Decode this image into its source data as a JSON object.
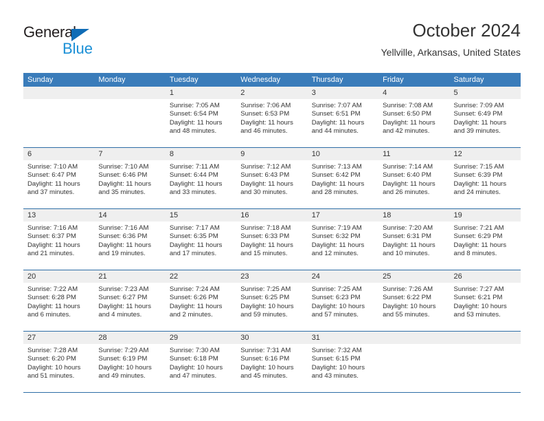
{
  "logo": {
    "word_top": "General",
    "word_bottom": "Blue",
    "triangle_color": "#0f6cb6",
    "blue_color": "#1a8fd6"
  },
  "header": {
    "title": "October 2024",
    "subtitle": "Yellville, Arkansas, United States"
  },
  "theme": {
    "header_blue": "#3a7cba",
    "rule_blue": "#2e6da6",
    "numbers_band": "#efefef",
    "text": "#333333"
  },
  "weekdays": [
    "Sunday",
    "Monday",
    "Tuesday",
    "Wednesday",
    "Thursday",
    "Friday",
    "Saturday"
  ],
  "weeks": [
    {
      "numbers": [
        "",
        "",
        "1",
        "2",
        "3",
        "4",
        "5"
      ],
      "days": [
        {
          "empty": true
        },
        {
          "empty": true
        },
        {
          "sunrise": "Sunrise: 7:05 AM",
          "sunset": "Sunset: 6:54 PM",
          "daylight1": "Daylight: 11 hours",
          "daylight2": "and 48 minutes."
        },
        {
          "sunrise": "Sunrise: 7:06 AM",
          "sunset": "Sunset: 6:53 PM",
          "daylight1": "Daylight: 11 hours",
          "daylight2": "and 46 minutes."
        },
        {
          "sunrise": "Sunrise: 7:07 AM",
          "sunset": "Sunset: 6:51 PM",
          "daylight1": "Daylight: 11 hours",
          "daylight2": "and 44 minutes."
        },
        {
          "sunrise": "Sunrise: 7:08 AM",
          "sunset": "Sunset: 6:50 PM",
          "daylight1": "Daylight: 11 hours",
          "daylight2": "and 42 minutes."
        },
        {
          "sunrise": "Sunrise: 7:09 AM",
          "sunset": "Sunset: 6:49 PM",
          "daylight1": "Daylight: 11 hours",
          "daylight2": "and 39 minutes."
        }
      ]
    },
    {
      "numbers": [
        "6",
        "7",
        "8",
        "9",
        "10",
        "11",
        "12"
      ],
      "days": [
        {
          "sunrise": "Sunrise: 7:10 AM",
          "sunset": "Sunset: 6:47 PM",
          "daylight1": "Daylight: 11 hours",
          "daylight2": "and 37 minutes."
        },
        {
          "sunrise": "Sunrise: 7:10 AM",
          "sunset": "Sunset: 6:46 PM",
          "daylight1": "Daylight: 11 hours",
          "daylight2": "and 35 minutes."
        },
        {
          "sunrise": "Sunrise: 7:11 AM",
          "sunset": "Sunset: 6:44 PM",
          "daylight1": "Daylight: 11 hours",
          "daylight2": "and 33 minutes."
        },
        {
          "sunrise": "Sunrise: 7:12 AM",
          "sunset": "Sunset: 6:43 PM",
          "daylight1": "Daylight: 11 hours",
          "daylight2": "and 30 minutes."
        },
        {
          "sunrise": "Sunrise: 7:13 AM",
          "sunset": "Sunset: 6:42 PM",
          "daylight1": "Daylight: 11 hours",
          "daylight2": "and 28 minutes."
        },
        {
          "sunrise": "Sunrise: 7:14 AM",
          "sunset": "Sunset: 6:40 PM",
          "daylight1": "Daylight: 11 hours",
          "daylight2": "and 26 minutes."
        },
        {
          "sunrise": "Sunrise: 7:15 AM",
          "sunset": "Sunset: 6:39 PM",
          "daylight1": "Daylight: 11 hours",
          "daylight2": "and 24 minutes."
        }
      ]
    },
    {
      "numbers": [
        "13",
        "14",
        "15",
        "16",
        "17",
        "18",
        "19"
      ],
      "days": [
        {
          "sunrise": "Sunrise: 7:16 AM",
          "sunset": "Sunset: 6:37 PM",
          "daylight1": "Daylight: 11 hours",
          "daylight2": "and 21 minutes."
        },
        {
          "sunrise": "Sunrise: 7:16 AM",
          "sunset": "Sunset: 6:36 PM",
          "daylight1": "Daylight: 11 hours",
          "daylight2": "and 19 minutes."
        },
        {
          "sunrise": "Sunrise: 7:17 AM",
          "sunset": "Sunset: 6:35 PM",
          "daylight1": "Daylight: 11 hours",
          "daylight2": "and 17 minutes."
        },
        {
          "sunrise": "Sunrise: 7:18 AM",
          "sunset": "Sunset: 6:33 PM",
          "daylight1": "Daylight: 11 hours",
          "daylight2": "and 15 minutes."
        },
        {
          "sunrise": "Sunrise: 7:19 AM",
          "sunset": "Sunset: 6:32 PM",
          "daylight1": "Daylight: 11 hours",
          "daylight2": "and 12 minutes."
        },
        {
          "sunrise": "Sunrise: 7:20 AM",
          "sunset": "Sunset: 6:31 PM",
          "daylight1": "Daylight: 11 hours",
          "daylight2": "and 10 minutes."
        },
        {
          "sunrise": "Sunrise: 7:21 AM",
          "sunset": "Sunset: 6:29 PM",
          "daylight1": "Daylight: 11 hours",
          "daylight2": "and 8 minutes."
        }
      ]
    },
    {
      "numbers": [
        "20",
        "21",
        "22",
        "23",
        "24",
        "25",
        "26"
      ],
      "days": [
        {
          "sunrise": "Sunrise: 7:22 AM",
          "sunset": "Sunset: 6:28 PM",
          "daylight1": "Daylight: 11 hours",
          "daylight2": "and 6 minutes."
        },
        {
          "sunrise": "Sunrise: 7:23 AM",
          "sunset": "Sunset: 6:27 PM",
          "daylight1": "Daylight: 11 hours",
          "daylight2": "and 4 minutes."
        },
        {
          "sunrise": "Sunrise: 7:24 AM",
          "sunset": "Sunset: 6:26 PM",
          "daylight1": "Daylight: 11 hours",
          "daylight2": "and 2 minutes."
        },
        {
          "sunrise": "Sunrise: 7:25 AM",
          "sunset": "Sunset: 6:25 PM",
          "daylight1": "Daylight: 10 hours",
          "daylight2": "and 59 minutes."
        },
        {
          "sunrise": "Sunrise: 7:25 AM",
          "sunset": "Sunset: 6:23 PM",
          "daylight1": "Daylight: 10 hours",
          "daylight2": "and 57 minutes."
        },
        {
          "sunrise": "Sunrise: 7:26 AM",
          "sunset": "Sunset: 6:22 PM",
          "daylight1": "Daylight: 10 hours",
          "daylight2": "and 55 minutes."
        },
        {
          "sunrise": "Sunrise: 7:27 AM",
          "sunset": "Sunset: 6:21 PM",
          "daylight1": "Daylight: 10 hours",
          "daylight2": "and 53 minutes."
        }
      ]
    },
    {
      "numbers": [
        "27",
        "28",
        "29",
        "30",
        "31",
        "",
        ""
      ],
      "days": [
        {
          "sunrise": "Sunrise: 7:28 AM",
          "sunset": "Sunset: 6:20 PM",
          "daylight1": "Daylight: 10 hours",
          "daylight2": "and 51 minutes."
        },
        {
          "sunrise": "Sunrise: 7:29 AM",
          "sunset": "Sunset: 6:19 PM",
          "daylight1": "Daylight: 10 hours",
          "daylight2": "and 49 minutes."
        },
        {
          "sunrise": "Sunrise: 7:30 AM",
          "sunset": "Sunset: 6:18 PM",
          "daylight1": "Daylight: 10 hours",
          "daylight2": "and 47 minutes."
        },
        {
          "sunrise": "Sunrise: 7:31 AM",
          "sunset": "Sunset: 6:16 PM",
          "daylight1": "Daylight: 10 hours",
          "daylight2": "and 45 minutes."
        },
        {
          "sunrise": "Sunrise: 7:32 AM",
          "sunset": "Sunset: 6:15 PM",
          "daylight1": "Daylight: 10 hours",
          "daylight2": "and 43 minutes."
        },
        {
          "empty": true
        },
        {
          "empty": true
        }
      ]
    }
  ]
}
